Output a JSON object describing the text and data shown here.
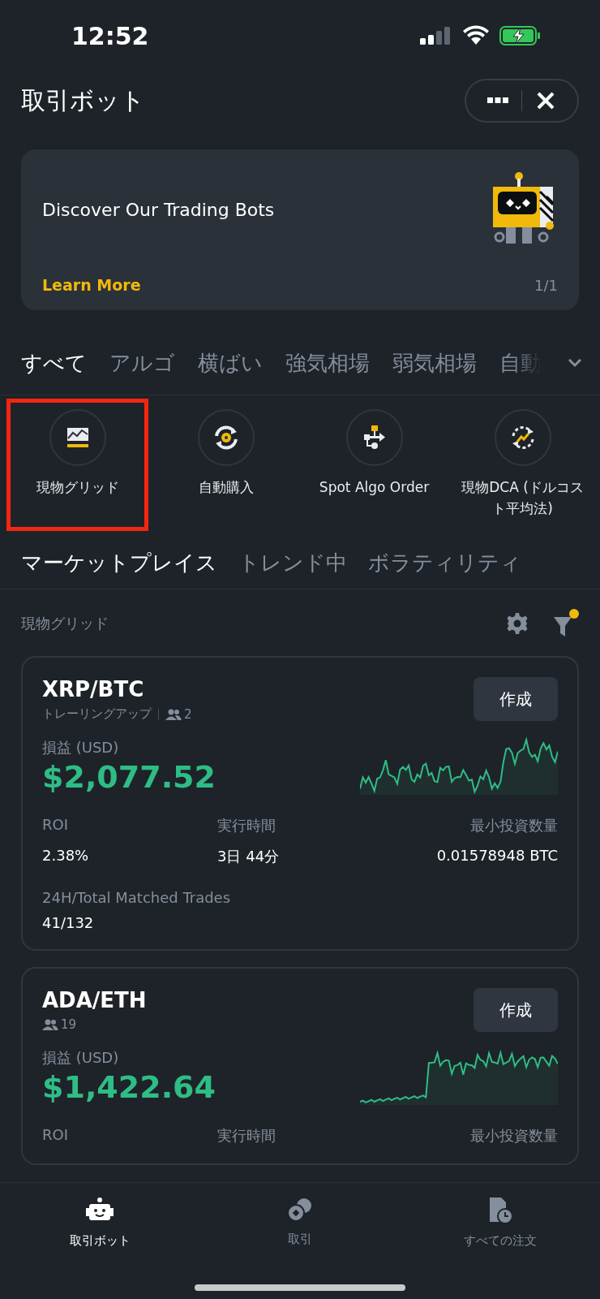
{
  "status_bar": {
    "time": "12:52"
  },
  "header": {
    "title": "取引ボット"
  },
  "banner": {
    "title": "Discover Our Trading Bots",
    "link": "Learn More",
    "page": "1/1"
  },
  "category_tabs": [
    {
      "label": "すべて",
      "selected": true
    },
    {
      "label": "アルゴ",
      "selected": false
    },
    {
      "label": "横ばい",
      "selected": false
    },
    {
      "label": "強気相場",
      "selected": false
    },
    {
      "label": "弱気相場",
      "selected": false
    },
    {
      "label": "自動",
      "selected": false
    }
  ],
  "bot_types": [
    {
      "kind": "grid",
      "label": "現物グリッド",
      "highlighted": true
    },
    {
      "kind": "recurring",
      "label": "自動購入",
      "highlighted": false
    },
    {
      "kind": "algo",
      "label": "Spot Algo Order",
      "highlighted": false
    },
    {
      "kind": "dca",
      "label": "現物DCA (ドルコスト平均法)",
      "highlighted": false
    }
  ],
  "market_tabs": [
    {
      "label": "マーケットプレイス",
      "selected": true
    },
    {
      "label": "トレンド中",
      "selected": false
    },
    {
      "label": "ボラティリティ",
      "selected": false
    }
  ],
  "section": {
    "title": "現物グリッド",
    "filter_active": true
  },
  "cards": [
    {
      "pair": "XRP/BTC",
      "strategy": "トレーリングアップ",
      "followers": "2",
      "button": "作成",
      "pnl_label": "損益 (USD)",
      "pnl": "$2,077.52",
      "stats": [
        {
          "label": "ROI",
          "value": "2.38%"
        },
        {
          "label": "実行時間",
          "value": "3日 44分"
        },
        {
          "label": "最小投資数量",
          "value": "0.01578948 BTC"
        }
      ],
      "trades_label": "24H/Total Matched Trades",
      "trades_value": "41/132"
    },
    {
      "pair": "ADA/ETH",
      "followers": "19",
      "button": "作成",
      "pnl_label": "損益 (USD)",
      "pnl": "$1,422.64",
      "stats": [
        {
          "label": "ROI"
        },
        {
          "label": "実行時間"
        },
        {
          "label": "最小投資数量"
        }
      ]
    }
  ],
  "bottom_nav": [
    {
      "kind": "bot",
      "label": "取引ボット",
      "selected": true
    },
    {
      "kind": "trade",
      "label": "取引",
      "selected": false
    },
    {
      "kind": "orders",
      "label": "すべての注文",
      "selected": false
    }
  ]
}
